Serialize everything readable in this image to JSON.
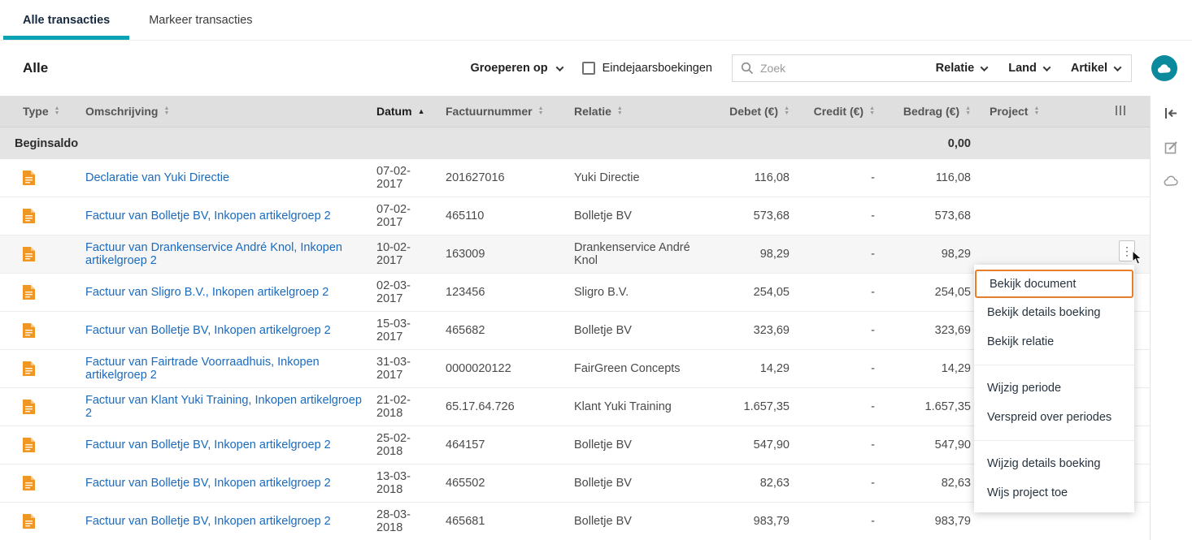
{
  "colors": {
    "accent": "#0aa3b3",
    "accent-dark": "#0b8a9d",
    "link": "#1a6bbf",
    "highlight": "#e87e2a",
    "doc-icon": "#ef9722"
  },
  "tabs": {
    "items": [
      {
        "label": "Alle transacties",
        "active": true
      },
      {
        "label": "Markeer transacties",
        "active": false
      }
    ]
  },
  "toolbar": {
    "title": "Alle",
    "group_by": "Groeperen op",
    "year_end_checkbox": "Eindejaarsboekingen",
    "year_end_checked": false,
    "search_placeholder": "Zoek",
    "filters": [
      {
        "label": "Relatie"
      },
      {
        "label": "Land"
      },
      {
        "label": "Artikel"
      }
    ]
  },
  "table": {
    "columns": [
      {
        "label": "Type",
        "sort": "both",
        "align": "left"
      },
      {
        "label": "Omschrijving",
        "sort": "both",
        "align": "left"
      },
      {
        "label": "Datum",
        "sort": "asc",
        "align": "left"
      },
      {
        "label": "Factuurnummer",
        "sort": "both",
        "align": "left"
      },
      {
        "label": "Relatie",
        "sort": "both",
        "align": "left"
      },
      {
        "label": "Debet (€)",
        "sort": "both",
        "align": "right"
      },
      {
        "label": "Credit (€)",
        "sort": "both",
        "align": "right"
      },
      {
        "label": "Bedrag (€)",
        "sort": "both",
        "align": "right"
      },
      {
        "label": "Project",
        "sort": "both",
        "align": "left"
      }
    ],
    "begin_row": {
      "label": "Beginsaldo",
      "bedrag": "0,00"
    },
    "rows": [
      {
        "omschrijving": "Declaratie van Yuki Directie",
        "datum": "07-02-2017",
        "factuurnummer": "201627016",
        "relatie": "Yuki Directie",
        "debet": "116,08",
        "credit": "-",
        "bedrag": "116,08",
        "menu_open": false
      },
      {
        "omschrijving": "Factuur van Bolletje BV, Inkopen artikelgroep 2",
        "datum": "07-02-2017",
        "factuurnummer": "465110",
        "relatie": "Bolletje BV",
        "debet": "573,68",
        "credit": "-",
        "bedrag": "573,68",
        "menu_open": false
      },
      {
        "omschrijving": "Factuur van Drankenservice André Knol, Inkopen artikelgroep 2",
        "datum": "10-02-2017",
        "factuurnummer": "163009",
        "relatie": "Drankenservice André Knol",
        "debet": "98,29",
        "credit": "-",
        "bedrag": "98,29",
        "menu_open": true
      },
      {
        "omschrijving": "Factuur van Sligro B.V., Inkopen artikelgroep 2",
        "datum": "02-03-2017",
        "factuurnummer": "123456",
        "relatie": "Sligro B.V.",
        "debet": "254,05",
        "credit": "-",
        "bedrag": "254,05",
        "menu_open": false
      },
      {
        "omschrijving": "Factuur van Bolletje BV, Inkopen artikelgroep 2",
        "datum": "15-03-2017",
        "factuurnummer": "465682",
        "relatie": "Bolletje BV",
        "debet": "323,69",
        "credit": "-",
        "bedrag": "323,69",
        "menu_open": false
      },
      {
        "omschrijving": "Factuur van Fairtrade Voorraadhuis, Inkopen artikelgroep 2",
        "datum": "31-03-2017",
        "factuurnummer": "0000020122",
        "relatie": "FairGreen Concepts",
        "debet": "14,29",
        "credit": "-",
        "bedrag": "14,29",
        "menu_open": false
      },
      {
        "omschrijving": "Factuur van Klant Yuki Training, Inkopen artikelgroep 2",
        "datum": "21-02-2018",
        "factuurnummer": "65.17.64.726",
        "relatie": "Klant Yuki Training",
        "debet": "1.657,35",
        "credit": "-",
        "bedrag": "1.657,35",
        "menu_open": false
      },
      {
        "omschrijving": "Factuur van Bolletje BV, Inkopen artikelgroep 2",
        "datum": "25-02-2018",
        "factuurnummer": "464157",
        "relatie": "Bolletje BV",
        "debet": "547,90",
        "credit": "-",
        "bedrag": "547,90",
        "menu_open": false
      },
      {
        "omschrijving": "Factuur van Bolletje BV, Inkopen artikelgroep 2",
        "datum": "13-03-2018",
        "factuurnummer": "465502",
        "relatie": "Bolletje BV",
        "debet": "82,63",
        "credit": "-",
        "bedrag": "82,63",
        "menu_open": false
      },
      {
        "omschrijving": "Factuur van Bolletje BV, Inkopen artikelgroep 2",
        "datum": "28-03-2018",
        "factuurnummer": "465681",
        "relatie": "Bolletje BV",
        "debet": "983,79",
        "credit": "-",
        "bedrag": "983,79",
        "menu_open": false
      }
    ]
  },
  "context_menu": {
    "items": [
      {
        "label": "Bekijk document",
        "highlighted": true
      },
      {
        "label": "Bekijk details boeking"
      },
      {
        "label": "Bekijk relatie"
      },
      {
        "divider": true
      },
      {
        "label": "Wijzig periode"
      },
      {
        "label": "Verspreid over periodes"
      },
      {
        "divider": true
      },
      {
        "label": "Wijzig details boeking"
      },
      {
        "label": "Wijs project toe"
      }
    ]
  }
}
